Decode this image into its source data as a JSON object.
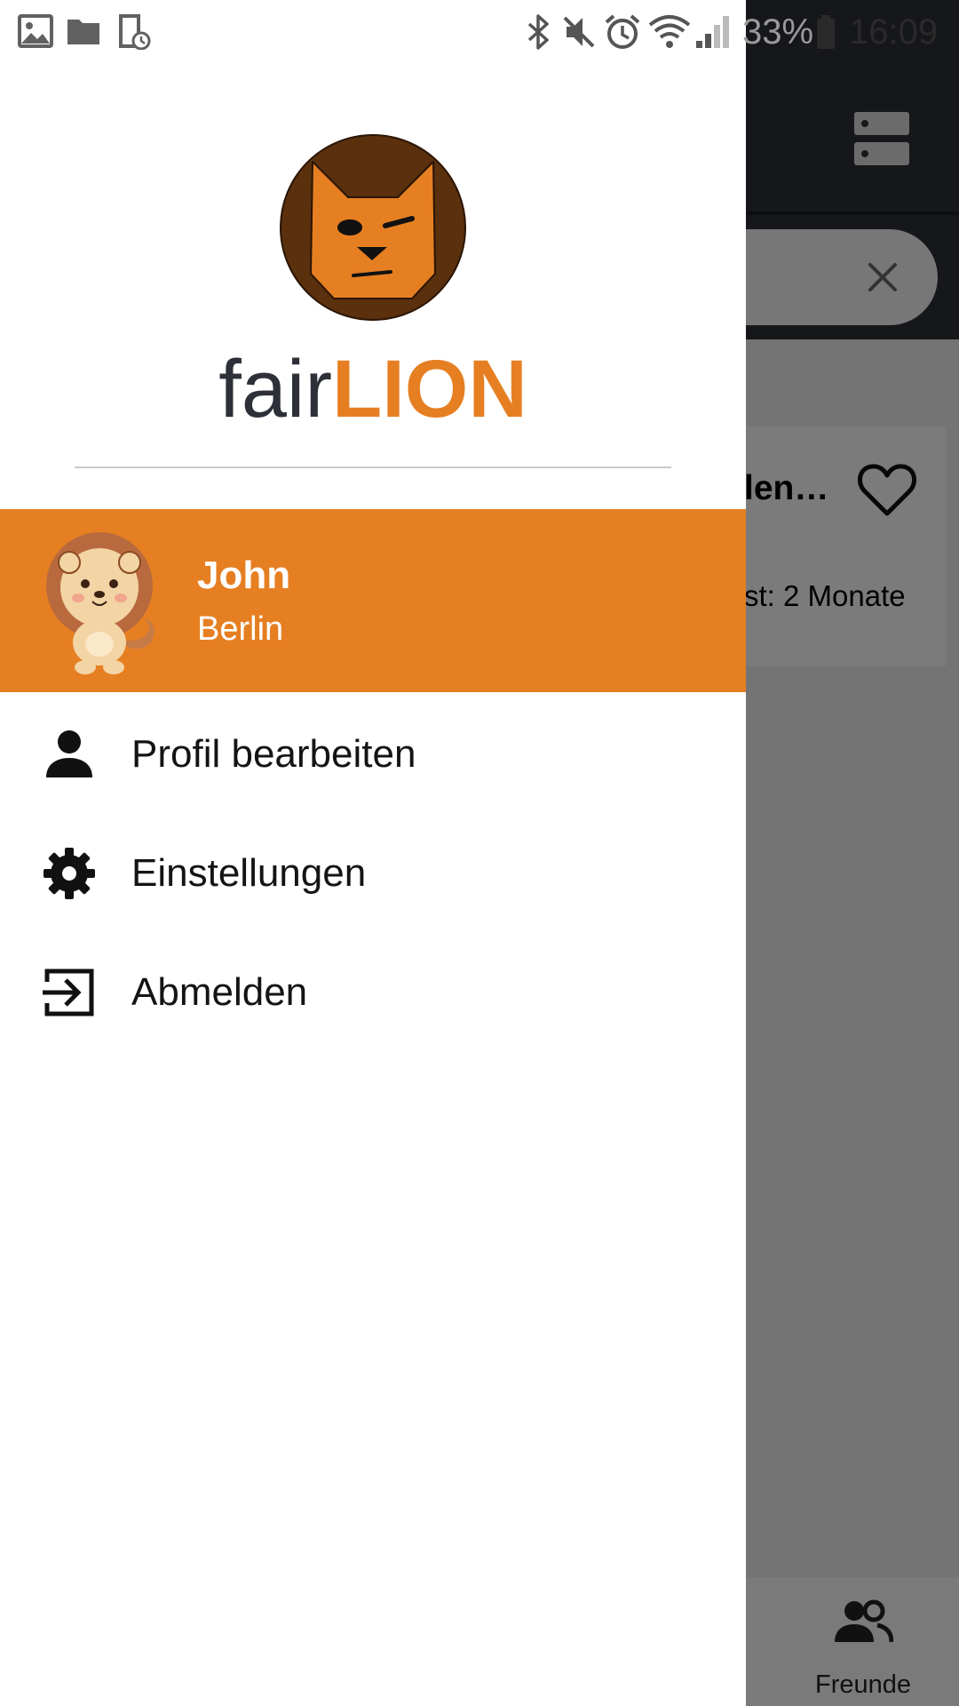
{
  "status_bar": {
    "battery": "33%",
    "time": "16:09",
    "icons": [
      "image-notification-icon",
      "folder-notification-icon",
      "download-notification-icon",
      "bluetooth-icon",
      "mute-icon",
      "alarm-icon",
      "wifi-icon",
      "signal-icon",
      "battery-icon"
    ]
  },
  "drawer": {
    "logo_icon": "fox-logo-icon",
    "brand": {
      "part1": "fair",
      "part2": "LION"
    },
    "user": {
      "name": "John",
      "city": "Berlin",
      "avatar": "lion-avatar"
    },
    "menu": [
      {
        "label": "Profil bearbeiten",
        "icon": "person-icon"
      },
      {
        "label": "Einstellungen",
        "icon": "gear-icon"
      },
      {
        "label": "Abmelden",
        "icon": "logout-icon"
      }
    ]
  },
  "background": {
    "card_title": "len…",
    "card_subtitle": "st: 2 Monate",
    "bottom_nav": {
      "friends_label": "Freunde"
    }
  },
  "colors": {
    "accent": "#e67f22",
    "brand_dark": "#2d3039",
    "appbar": "#2c2e35"
  }
}
